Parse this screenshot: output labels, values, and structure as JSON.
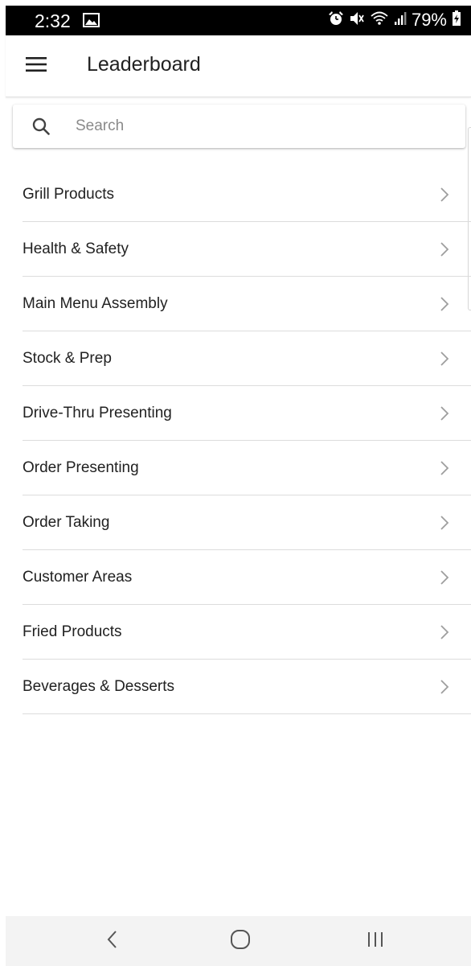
{
  "status_bar": {
    "time": "2:32",
    "battery_percent": "79%",
    "icons": [
      "gallery-icon",
      "alarm-icon",
      "mute-icon",
      "wifi-icon",
      "signal-icon",
      "battery-icon"
    ]
  },
  "app_bar": {
    "title": "Leaderboard",
    "menu_icon": "hamburger-menu-icon"
  },
  "search": {
    "placeholder": "Search",
    "value": "",
    "icon": "search-icon"
  },
  "categories": [
    {
      "label": "Grill Products"
    },
    {
      "label": "Health & Safety"
    },
    {
      "label": "Main Menu Assembly"
    },
    {
      "label": "Stock & Prep"
    },
    {
      "label": "Drive-Thru Presenting"
    },
    {
      "label": "Order Presenting"
    },
    {
      "label": "Order Taking"
    },
    {
      "label": "Customer Areas"
    },
    {
      "label": "Fried Products"
    },
    {
      "label": "Beverages & Desserts"
    }
  ],
  "nav_bar": {
    "icons": [
      "back-icon",
      "home-icon",
      "recent-apps-icon"
    ]
  },
  "colors": {
    "status_bar_bg": "#000000",
    "text_primary": "#212121",
    "placeholder": "#8a8a8a",
    "divider": "#dcdcdc",
    "chevron": "#9e9e9e",
    "nav_bar_bg": "#f3f3f3"
  }
}
